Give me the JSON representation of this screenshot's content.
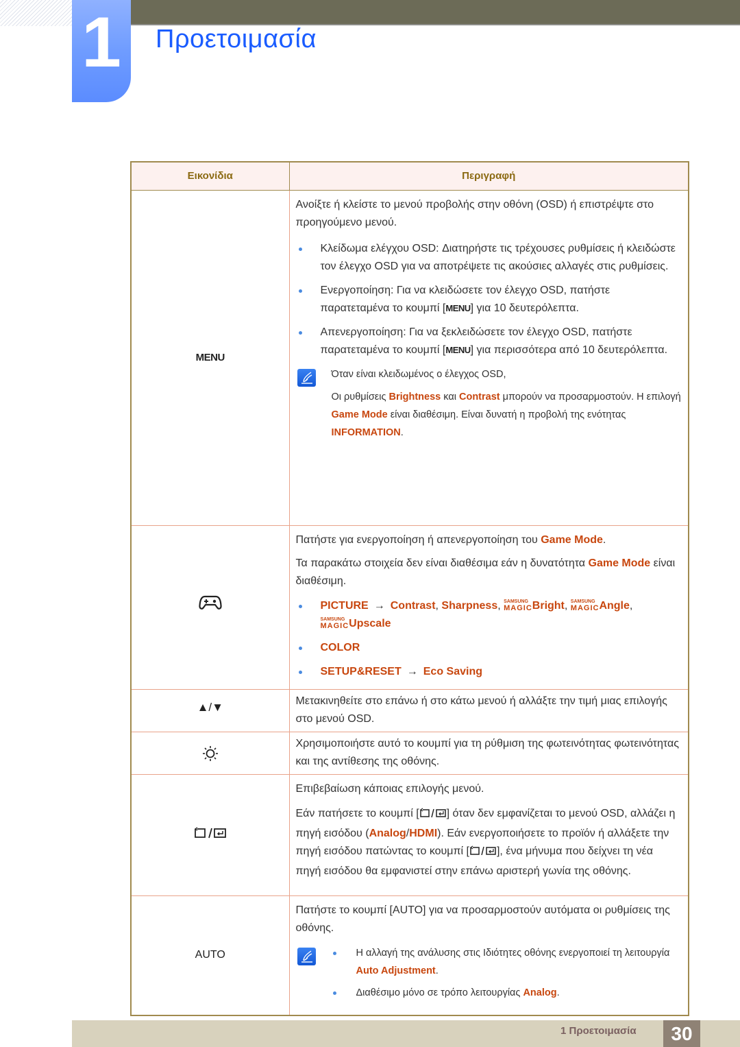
{
  "header": {
    "chapter_number": "1",
    "chapter_title": "Προετοιμασία"
  },
  "table": {
    "headers": [
      "Εικονίδια",
      "Περιγραφή"
    ],
    "rows": [
      {
        "icon_label": "MENU",
        "icon_name": "menu-key",
        "intro": "Ανοίξτε ή κλείστε το μενού προβολής στην οθόνη (OSD) ή επιστρέψτε στο προηγούμενο μενού.",
        "bullets": [
          {
            "text": "Κλείδωμα ελέγχου OSD: Διατηρήστε τις τρέχουσες ρυθμίσεις ή κλειδώστε τον έλεγχο OSD για να αποτρέψετε τις ακούσιες αλλαγές στις ρυθμίσεις."
          },
          {
            "pre": "Ενεργοποίηση: Για να κλειδώσετε τον έλεγχο OSD, πατήστε παρατεταμένα το κουμπί [",
            "key": "MENU",
            "post": "] για 10 δευτερόλεπτα."
          },
          {
            "pre": "Απενεργοποίηση: Για να ξεκλειδώσετε τον έλεγχο OSD, πατήστε παρατεταμένα το κουμπί [",
            "key": "MENU",
            "post": "] για περισσότερα από 10 δευτερόλεπτα."
          }
        ],
        "note": {
          "line1": "Όταν είναι κλειδωμένος ο έλεγχος OSD,",
          "p1": "Οι ρυθμίσεις ",
          "h1": "Brightness",
          "p2": " και ",
          "h2": "Contrast",
          "p3": " μπορούν να προσαρμοστούν. Η επιλογή ",
          "h3": "Game Mode",
          "p4": " είναι διαθέσιμη. Είναι δυνατή η προβολή της ενότητας ",
          "h4": "INFORMATION",
          "p5": "."
        }
      },
      {
        "icon_name": "gamepad",
        "intro_pre": "Πατήστε για ενεργοποίηση ή απενεργοποίηση του ",
        "intro_hl": "Game Mode",
        "intro_post": ".",
        "p2_pre": "Τα παρακάτω στοιχεία δεν είναι διαθέσιμα εάν η δυνατότητα ",
        "p2_hl": "Game Mode",
        "p2_post": " είναι διαθέσιμη.",
        "magic_top": "SAMSUNG",
        "magic_bottom": "MAGIC",
        "bullets": [
          {
            "menu": "PICTURE",
            "arrow": "→",
            "items": [
              "Contrast",
              "Sharpness"
            ],
            "magic_items": [
              "Bright",
              "Angle",
              "Upscale"
            ]
          },
          {
            "menu": "COLOR"
          },
          {
            "menu": "SETUP&RESET",
            "arrow": "→",
            "items": [
              "Eco Saving"
            ]
          }
        ]
      },
      {
        "icon_label": "▲/▼",
        "icon_name": "up-down-arrows",
        "text": "Μετακινηθείτε στο επάνω ή στο κάτω μενού ή αλλάξτε την τιμή μιας επιλογής στο μενού OSD."
      },
      {
        "icon_name": "brightness-sun",
        "text": "Χρησιμοποιήστε αυτό το κουμπί για τη ρύθμιση της φωτεινότητας φωτεινότητας και της αντίθεσης της οθόνης."
      },
      {
        "icon_name": "enter-source",
        "intro": "Επιβεβαίωση κάποιας επιλογής μενού.",
        "p1": "Εάν πατήσετε το κουμπί [",
        "p2": "] όταν δεν εμφανίζεται το μενού OSD, αλλάζει η πηγή εισόδου (",
        "h1": "Analog",
        "slash": "/",
        "h2": "HDMI",
        "p3": "). Εάν ενεργοποιήσετε το προϊόν ή αλλάξετε την πηγή εισόδου πατώντας το κουμπί [",
        "p4": "], ένα μήνυμα που δείχνει τη νέα πηγή εισόδου θα εμφανιστεί στην επάνω αριστερή γωνία της οθόνης."
      },
      {
        "icon_label": "AUTO",
        "icon_name": "auto-key",
        "intro_pre": "Πατήστε το κουμπί [",
        "intro_key": "AUTO",
        "intro_post": "] για να προσαρμοστούν αυτόματα οι ρυθμίσεις της οθόνης.",
        "note_bullets": [
          {
            "pre": "Η αλλαγή της ανάλυσης στις Ιδιότητες οθόνης ενεργοποιεί τη λειτουργία ",
            "hl": "Auto Adjustment",
            "post": "."
          },
          {
            "pre": "Διαθέσιμο μόνο σε τρόπο λειτουργίας ",
            "hl": "Analog",
            "post": "."
          }
        ]
      }
    ]
  },
  "footer": {
    "section_label": "1 Προετοιμασία",
    "page_number": "30"
  },
  "colors": {
    "accent_blue": "#1a5cff",
    "highlight_orange": "#c8470f",
    "header_text": "#8b6a12",
    "top_bar": "#6c6b57",
    "footer_bar": "#d8d2bd",
    "page_number_bg": "#8f8275"
  }
}
